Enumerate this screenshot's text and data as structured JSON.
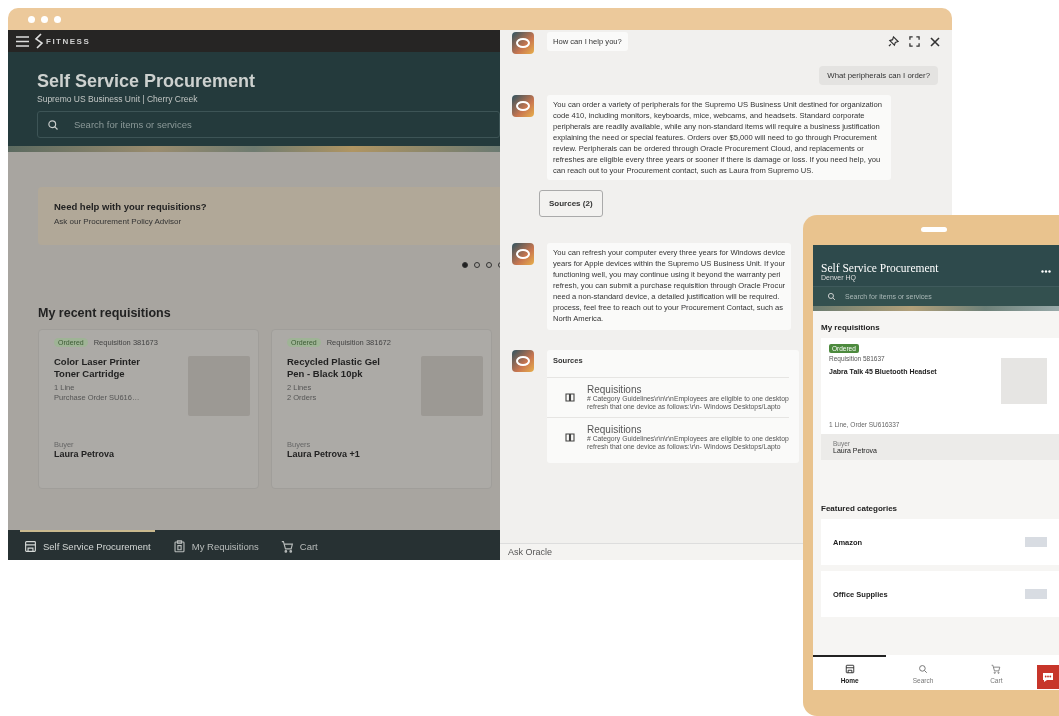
{
  "app": {
    "logo": "FITNESS",
    "title": "Self Service Procurement",
    "subtitle": "Supremo US Business Unit | Cherry Creek",
    "search": {
      "placeholder": "Search for items or services"
    },
    "help_card": {
      "title": "Need help with your requisitions?",
      "text": "Ask our Procurement Policy Advisor"
    },
    "carousel_dots": [
      {
        "selected": true
      },
      {
        "selected": false
      },
      {
        "selected": false
      },
      {
        "selected": false
      }
    ],
    "section_title": "My recent requisitions",
    "cards": [
      {
        "status": "Ordered",
        "requisition": "Requisition 381673",
        "title": "Color Laser Printer Toner Cartridge",
        "details": [
          "1 Line",
          "Purchase Order SU616…"
        ],
        "buyer_label": "Buyer",
        "buyer": "Laura Petrova"
      },
      {
        "status": "Ordered",
        "requisition": "Requisition 381672",
        "title": "Recycled Plastic Gel Pen - Black 10pk",
        "details": [
          "2 Lines",
          "2 Orders"
        ],
        "buyer_label": "Buyers",
        "buyer": "Laura Petrova +1"
      }
    ],
    "nav": [
      {
        "kind": "store",
        "label": "Self Service Procurement",
        "selected": true
      },
      {
        "kind": "clipboard",
        "label": "My Requisitions",
        "selected": false
      },
      {
        "kind": "cart",
        "label": "Cart",
        "selected": false
      }
    ]
  },
  "chat": {
    "messages": [
      {
        "kind": "bot",
        "text": "How can I help you?"
      },
      {
        "kind": "user",
        "text": "What peripherals can I order?"
      },
      {
        "kind": "bot",
        "text": "You can order a variety of peripherals for the Supremo US Business Unit destined for organization code 410, including monitors, keyboards, mice, webcams, and headsets. Standard corporate peripherals are readily available, while any non-standard items will require a business justification explaining the need or special features. Orders over $5,000 will need to go through Procurement review. Peripherals can be ordered through Oracle Procurement Cloud, and replacements or refreshes are eligible every three years or sooner if there is damage or loss. If you need help, you can reach out to your Procurement contact, such as Laura from Supremo US."
      },
      {
        "kind": "button",
        "text": "Sources (2)"
      },
      {
        "kind": "bot_lines",
        "lines": [
          "You can refresh your computer every three years for Windows device",
          "years for Apple devices within the Supremo US Business Unit. If your",
          "functioning well, you may continue using it beyond the warranty peri",
          "refresh, you can submit a purchase requisition through Oracle Procur",
          "need a non-standard device, a detailed justification will be required.",
          "process, feel free to reach out to your Procurement Contact, such as",
          "North America."
        ]
      },
      {
        "kind": "sources",
        "title": "Sources",
        "items": [
          {
            "title": "Requisitions",
            "lines": [
              "# Category Guidelines\\r\\n\\r\\nEmployees are eligible to one desktop",
              "refresh that one device as follows:\\r\\n- Windows Desktops/Lapto"
            ]
          },
          {
            "title": "Requisitions",
            "lines": [
              "# Category Guidelines\\r\\n\\r\\nEmployees are eligible to one desktop",
              "refresh that one device as follows:\\r\\n- Windows Desktops/Lapto"
            ]
          }
        ]
      }
    ],
    "input": {
      "placeholder": "Ask Oracle"
    }
  },
  "phone": {
    "title": "Self Service Procurement",
    "subtitle": "Denver HQ",
    "search": {
      "placeholder": "Search for items or services"
    },
    "section_title": "My requisitions",
    "card": {
      "status": "Ordered",
      "requisition": "Requisition 581637",
      "title": "Jabra Talk 45 Bluetooth Headset",
      "detail": "1 Line, Order SU616337",
      "buyer_label": "Buyer",
      "buyer": "Laura Petrova"
    },
    "featured_title": "Featured categories",
    "categories": [
      "Amazon",
      "Office Supplies"
    ],
    "nav": [
      {
        "kind": "home",
        "label": "Home",
        "selected": true
      },
      {
        "kind": "search",
        "label": "Search",
        "selected": false
      },
      {
        "kind": "cart",
        "label": "Cart",
        "selected": false
      }
    ]
  }
}
